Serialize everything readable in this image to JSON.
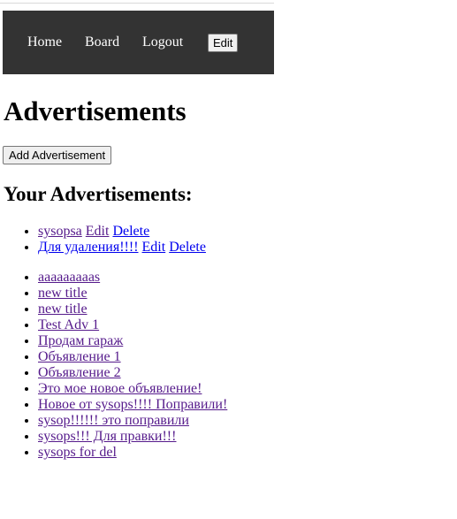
{
  "nav": {
    "home": "Home",
    "board": "Board",
    "logout": "Logout",
    "edit": "Edit"
  },
  "page_title": "Advertisements",
  "add_button": "Add Advertisement",
  "your_ads_heading": "Your Advertisements:",
  "your_ads": [
    {
      "title": "sysopsa",
      "edit": "Edit",
      "delete": "Delete"
    },
    {
      "title": "Для удаления!!!!",
      "edit": "Edit",
      "delete": "Delete"
    }
  ],
  "all_ads": [
    "aaaaaaaaas",
    "new title",
    "new title",
    "Test Adv 1",
    "Продам гараж",
    "Объявление 1",
    "Объявление 2",
    "Это мое новое объявление!",
    "Новое от sysops!!!! Поправили!",
    "sysop!!!!!! это поправили",
    "sysops!!! Для правки!!!",
    "sysops for del"
  ],
  "colors": {
    "navbar_bg": "#333333",
    "link_visited": "#551a8b",
    "link_unvisited": "#0000ee"
  }
}
